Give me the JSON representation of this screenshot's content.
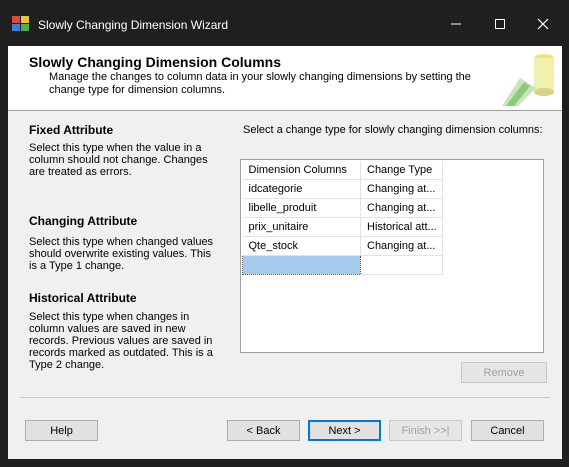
{
  "window": {
    "title": "Slowly Changing Dimension Wizard",
    "accent": "#1f1f1f"
  },
  "header": {
    "title": "Slowly Changing Dimension Columns",
    "description": "Manage the changes to column data in your slowly changing dimensions by setting the change type for dimension columns."
  },
  "sections": [
    {
      "title": "Fixed Attribute",
      "text": "Select this type when the value in a column should not change. Changes are treated as errors."
    },
    {
      "title": "Changing Attribute",
      "text": "Select this type when changed values should overwrite existing values. This is a Type 1 change."
    },
    {
      "title": "Historical Attribute",
      "text": "Select this type when changes in column values are saved in new records. Previous values are saved in records marked as outdated. This is a Type 2 change."
    }
  ],
  "grid": {
    "caption": "Select a change type for slowly changing dimension columns:",
    "columns": [
      "Dimension Columns",
      "Change Type"
    ],
    "rows": [
      {
        "column": "idcategorie",
        "type": "Changing at..."
      },
      {
        "column": "libelle_produit",
        "type": "Changing at..."
      },
      {
        "column": "prix_unitaire",
        "type": "Historical att..."
      },
      {
        "column": "Qte_stock",
        "type": "Changing at..."
      }
    ],
    "selection_color": "#a6caf0"
  },
  "buttons": {
    "remove": "Remove",
    "help": "Help",
    "back": "< Back",
    "next": "Next >",
    "finish": "Finish >>|",
    "cancel": "Cancel"
  }
}
